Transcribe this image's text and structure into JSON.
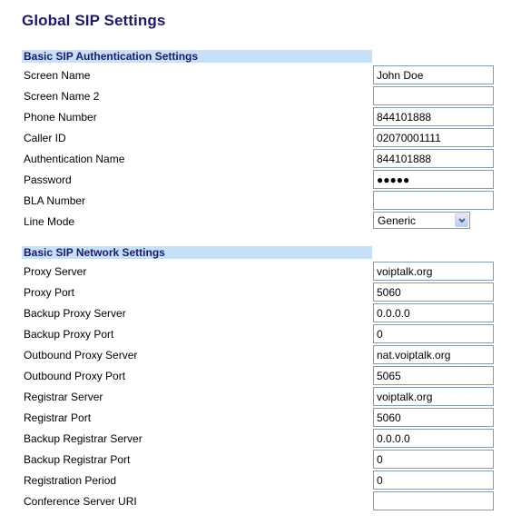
{
  "page": {
    "title": "Global SIP Settings"
  },
  "auth_section": {
    "header": "Basic SIP Authentication Settings",
    "fields": [
      {
        "label": "Screen Name",
        "value": "John Doe",
        "type": "text"
      },
      {
        "label": "Screen Name 2",
        "value": "",
        "type": "text"
      },
      {
        "label": "Phone Number",
        "value": "844101888",
        "type": "text"
      },
      {
        "label": "Caller ID",
        "value": "02070001111",
        "type": "text"
      },
      {
        "label": "Authentication Name",
        "value": "844101888",
        "type": "text"
      },
      {
        "label": "Password",
        "value": "●●●●●",
        "type": "password"
      },
      {
        "label": "BLA Number",
        "value": "",
        "type": "text"
      },
      {
        "label": "Line Mode",
        "value": "Generic",
        "type": "select",
        "icon": "chevron-down-icon"
      }
    ]
  },
  "network_section": {
    "header": "Basic SIP Network Settings",
    "fields": [
      {
        "label": "Proxy Server",
        "value": "voiptalk.org"
      },
      {
        "label": "Proxy Port",
        "value": "5060"
      },
      {
        "label": "Backup Proxy Server",
        "value": "0.0.0.0"
      },
      {
        "label": "Backup Proxy Port",
        "value": "0"
      },
      {
        "label": "Outbound Proxy Server",
        "value": "nat.voiptalk.org"
      },
      {
        "label": "Outbound Proxy Port",
        "value": "5065"
      },
      {
        "label": "Registrar Server",
        "value": "voiptalk.org"
      },
      {
        "label": "Registrar Port",
        "value": "5060"
      },
      {
        "label": "Backup Registrar Server",
        "value": "0.0.0.0"
      },
      {
        "label": "Backup Registrar Port",
        "value": "0"
      },
      {
        "label": "Registration Period",
        "value": "0"
      },
      {
        "label": "Conference Server URI",
        "value": ""
      }
    ]
  }
}
